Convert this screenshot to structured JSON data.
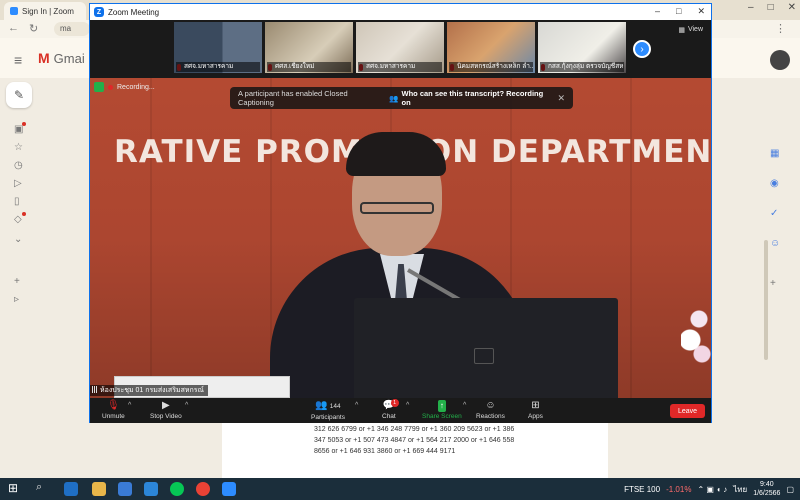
{
  "browser": {
    "tab_title": "Sign In | Zoom",
    "address_fragment": "ma",
    "new_tab_icon": "plus-icon"
  },
  "gmail": {
    "logo_text": "Gmai",
    "mail_text": "312 626 6799 or +1 346 248 7799 or +1 360 209 5623 or +1 386 347 5053 or +1 507 473 4847 or +1 564 217 2000 or +1 646 558 8656 or +1 646 931 3860 or +1 669 444 9171"
  },
  "zoom": {
    "window_title": "Zoom Meeting",
    "view_label": "View",
    "thumbnails": [
      {
        "name": "สศจ.มหาสารคาม"
      },
      {
        "name": "ศศส.เชียงใหม่"
      },
      {
        "name": "สศจ.มหาสารคาม"
      },
      {
        "name": "นิคมสหกรณ์สร้างเหล็ก ลำ..."
      },
      {
        "name": "กสส.กุ้งกุงลุ่ม ตรวจบัญชีสหกรณ์"
      }
    ],
    "recording_label": "Recording...",
    "banner": {
      "message": "A participant has enabled Closed Captioning",
      "link": "Who can see this transcript? Recording on"
    },
    "wall_sign": "RATIVE PROMOTION DEPARTMENT",
    "speaker_name": "ห้องประชุม 01 กรมส่งเสริมสหกรณ์",
    "controls": {
      "unmute": "Unmute",
      "stop_video": "Stop Video",
      "participants": "Participants",
      "participants_count": "144",
      "chat": "Chat",
      "chat_badge": "1",
      "share_screen": "Share Screen",
      "reactions": "Reactions",
      "apps": "Apps",
      "leave": "Leave"
    }
  },
  "taskbar": {
    "ticker": "FTSE 100",
    "ticker_change": "-1.01%",
    "language": "ไทย",
    "time": "9:40",
    "date": "1/6/2566"
  },
  "colors": {
    "zoom_blue": "#0e71eb",
    "share_green": "#23b04a",
    "leave_red": "#e02828",
    "wall_red": "#ac4630"
  }
}
